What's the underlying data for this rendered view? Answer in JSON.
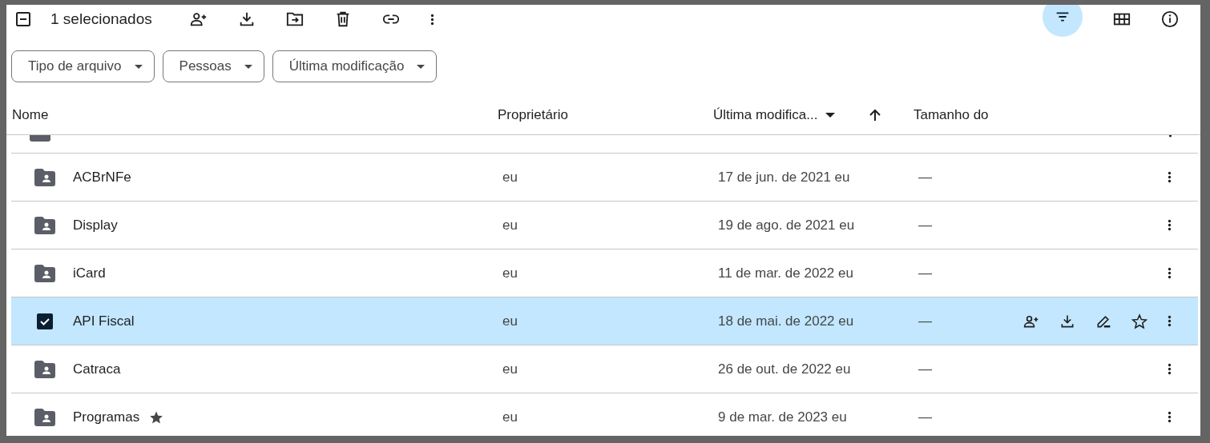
{
  "toolbar": {
    "selection_label": "1 selecionados",
    "filter_toggle": {
      "selected": true
    }
  },
  "filters": [
    {
      "label": "Tipo de arquivo"
    },
    {
      "label": "Pessoas"
    },
    {
      "label": "Última modificação"
    }
  ],
  "columns": [
    {
      "label": "Nome"
    },
    {
      "label": "Proprietário"
    },
    {
      "label": "Última modifica..."
    },
    {
      "label": "Tamanho do"
    }
  ],
  "rows": [
    {
      "name": "ACBrNFe",
      "owner": "eu",
      "modified": "17 de jun. de 2021 eu",
      "size": "—",
      "selected": false,
      "starred": false
    },
    {
      "name": "Display",
      "owner": "eu",
      "modified": "19 de ago. de 2021 eu",
      "size": "—",
      "selected": false,
      "starred": false
    },
    {
      "name": "iCard",
      "owner": "eu",
      "modified": "11 de mar. de 2022 eu",
      "size": "—",
      "selected": false,
      "starred": false
    },
    {
      "name": "API Fiscal",
      "owner": "eu",
      "modified": "18 de mai. de 2022 eu",
      "size": "—",
      "selected": true,
      "starred": false
    },
    {
      "name": "Catraca",
      "owner": "eu",
      "modified": "26 de out. de 2022 eu",
      "size": "—",
      "selected": false,
      "starred": false
    },
    {
      "name": "Programas",
      "owner": "eu",
      "modified": "9 de mar. de 2023 eu",
      "size": "—",
      "selected": false,
      "starred": true
    }
  ]
}
